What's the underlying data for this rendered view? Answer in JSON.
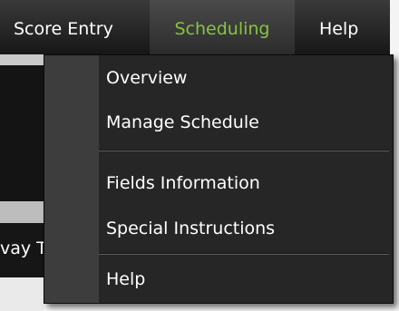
{
  "menubar": {
    "items": [
      {
        "label": "Score Entry"
      },
      {
        "label": "Scheduling",
        "active": true
      },
      {
        "label": "Help"
      }
    ],
    "active_color": "#86c43f"
  },
  "background": {
    "partial_text": "vay T"
  },
  "dropdown": {
    "items": [
      {
        "label": "Overview"
      },
      {
        "label": "Manage Schedule"
      },
      {
        "label": "Fields Information"
      },
      {
        "label": "Special Instructions"
      },
      {
        "label": "Help"
      }
    ]
  }
}
